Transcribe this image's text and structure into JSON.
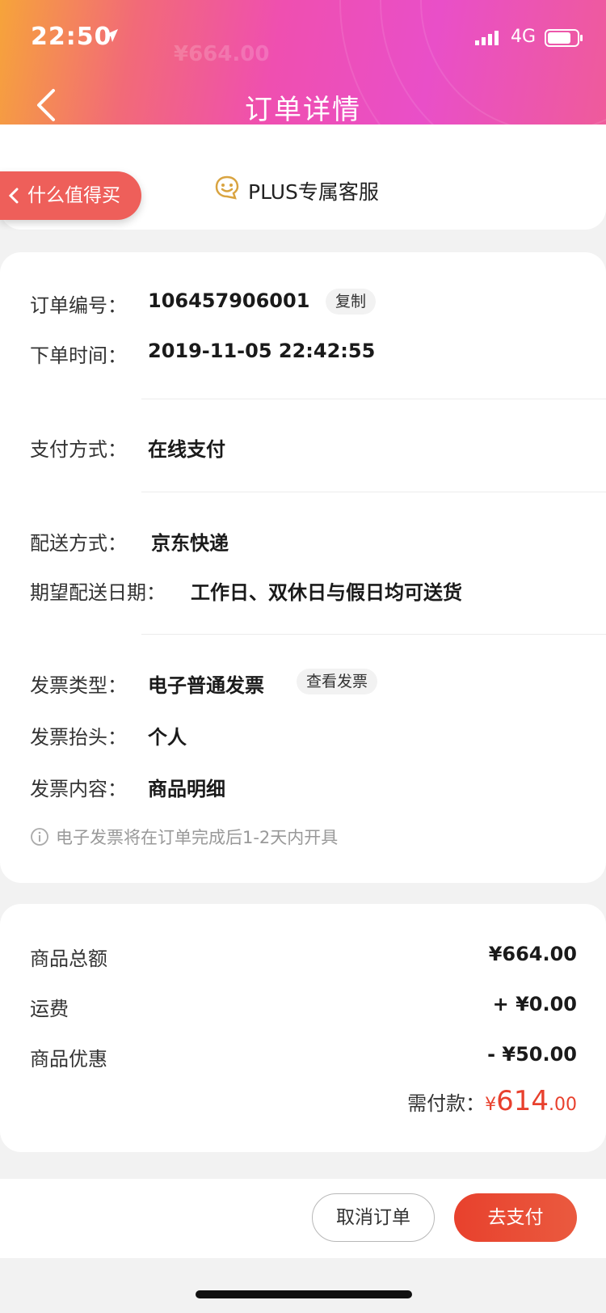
{
  "status_bar": {
    "time": "22:50",
    "network": "4G"
  },
  "header": {
    "title": "订单详情",
    "ghost_price": "¥664.00"
  },
  "service": {
    "smzdm_label": "什么值得买",
    "plus_label": "PLUS专属客服"
  },
  "order": {
    "number_label": "订单编号：",
    "number_value": "106457906001",
    "copy_label": "复制",
    "time_label": "下单时间：",
    "time_value": "2019-11-05 22:42:55",
    "payment_label": "支付方式：",
    "payment_value": "在线支付",
    "delivery_label": "配送方式：",
    "delivery_value": "京东快递",
    "expect_label": "期望配送日期：",
    "expect_value": "工作日、双休日与假日均可送货",
    "invoice_type_label": "发票类型：",
    "invoice_type_value": "电子普通发票",
    "view_invoice_label": "查看发票",
    "invoice_title_label": "发票抬头：",
    "invoice_title_value": "个人",
    "invoice_content_label": "发票内容：",
    "invoice_content_value": "商品明细",
    "invoice_hint": "电子发票将在订单完成后1-2天内开具"
  },
  "amounts": {
    "total_label": "商品总额",
    "total_value": "¥664.00",
    "shipping_label": "运费",
    "shipping_value": "+ ¥0.00",
    "discount_label": "商品优惠",
    "discount_value": "- ¥50.00",
    "due_label": "需付款：",
    "due_currency": "¥",
    "due_integer": "614",
    "due_decimal": ".00"
  },
  "actions": {
    "cancel_label": "取消订单",
    "pay_label": "去支付"
  },
  "colors": {
    "accent": "#e8402d",
    "header_pink": "#ef4fb0",
    "header_orange": "#f6a43a",
    "smzdm_red": "#ee5f5a"
  }
}
